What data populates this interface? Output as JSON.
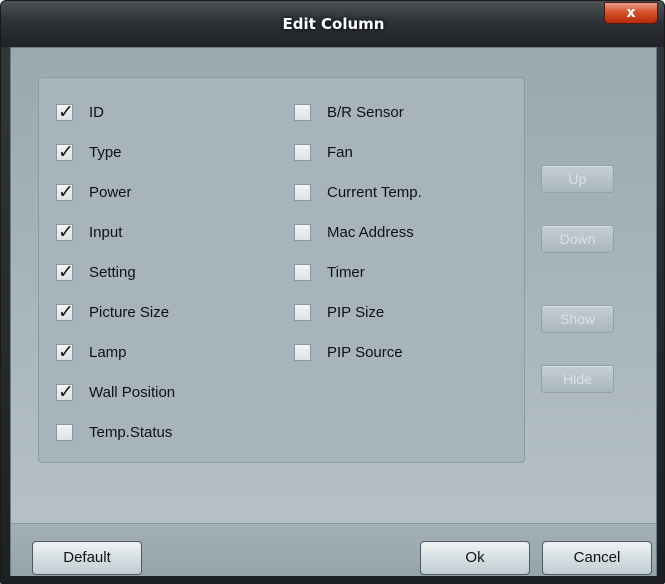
{
  "window": {
    "title": "Edit Column",
    "close_label": "x"
  },
  "columns_left": [
    {
      "label": "ID",
      "checked": true
    },
    {
      "label": "Type",
      "checked": true
    },
    {
      "label": "Power",
      "checked": true
    },
    {
      "label": "Input",
      "checked": true
    },
    {
      "label": "Setting",
      "checked": true
    },
    {
      "label": "Picture Size",
      "checked": true
    },
    {
      "label": "Lamp",
      "checked": true
    },
    {
      "label": "Wall Position",
      "checked": true
    },
    {
      "label": "Temp.Status",
      "checked": false
    }
  ],
  "columns_right": [
    {
      "label": "B/R Sensor",
      "checked": false
    },
    {
      "label": "Fan",
      "checked": false
    },
    {
      "label": "Current Temp.",
      "checked": false
    },
    {
      "label": "Mac Address",
      "checked": false
    },
    {
      "label": "Timer",
      "checked": false
    },
    {
      "label": "PIP Size",
      "checked": false
    },
    {
      "label": "PIP Source",
      "checked": false
    }
  ],
  "side_buttons": {
    "up": "Up",
    "down": "Down",
    "show": "Show",
    "hide": "Hide"
  },
  "footer": {
    "default": "Default",
    "ok": "Ok",
    "cancel": "Cancel"
  },
  "check_glyph": "✓"
}
